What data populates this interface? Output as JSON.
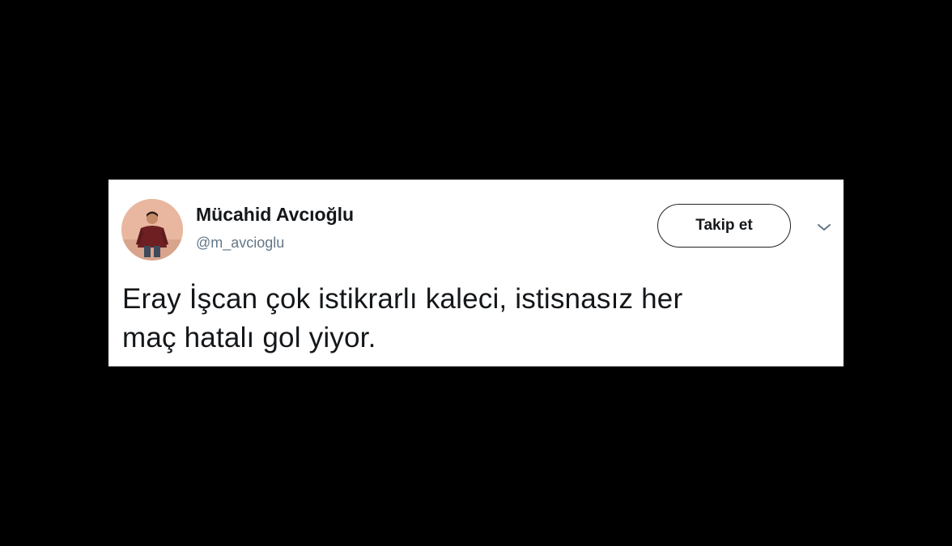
{
  "tweet": {
    "author": {
      "display_name": "Mücahid Avcıoğlu",
      "handle": "@m_avcioglu",
      "avatar_icon": "user-avatar-photo"
    },
    "follow_button_label": "Takip et",
    "menu_icon": "chevron-down-icon",
    "text_lines": [
      "Eray İşcan çok istikrarlı kaleci, istisnasız her",
      "maç hatalı gol yiyor."
    ]
  },
  "colors": {
    "background": "#000000",
    "card": "#ffffff",
    "name_text": "#14171a",
    "handle_text": "#657786",
    "button_border": "#222222"
  }
}
